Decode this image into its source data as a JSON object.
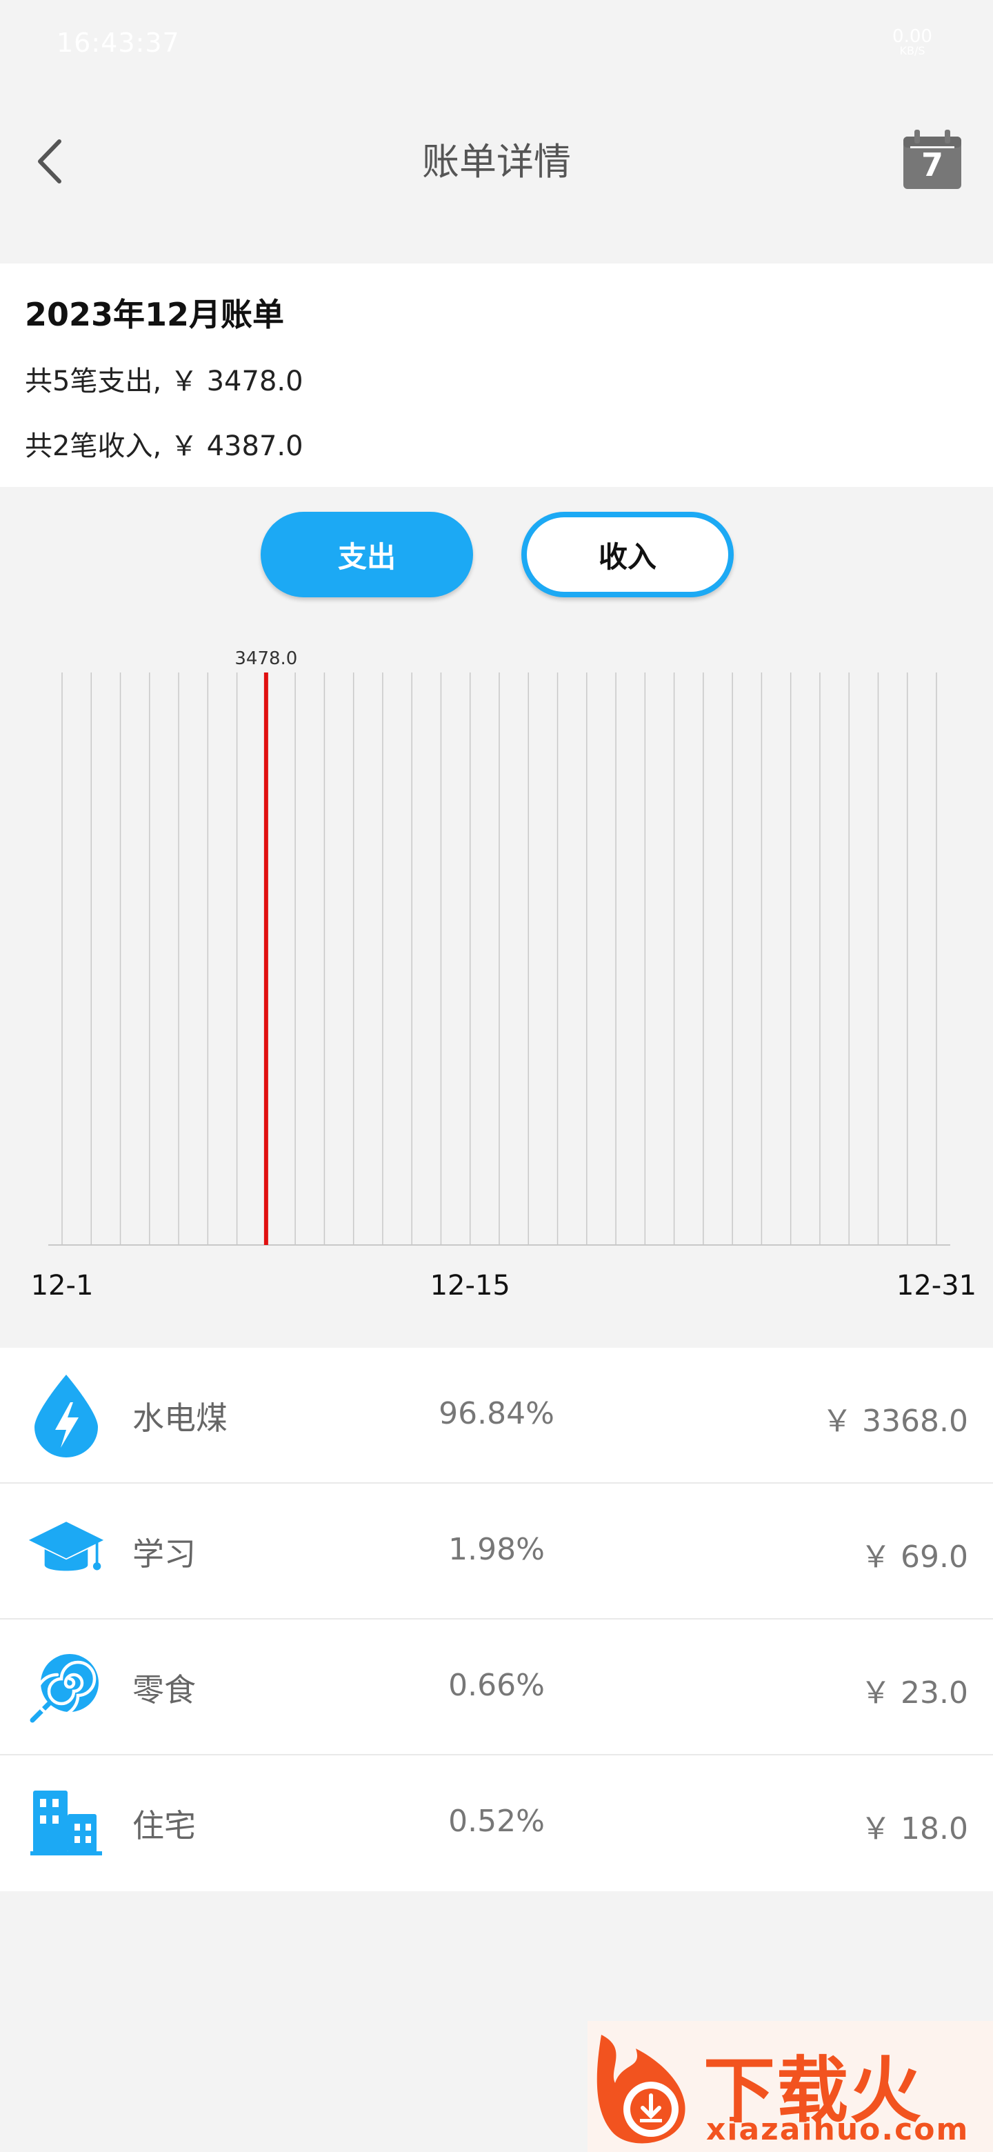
{
  "status_bar": {
    "time": "16:43:37",
    "net_speed": "0.00",
    "net_unit": "KB/S"
  },
  "header": {
    "title": "账单详情",
    "calendar_day": "7"
  },
  "summary": {
    "title": "2023年12月账单",
    "expense_line": "共5笔支出, ￥ 3478.0",
    "income_line": "共2笔收入, ￥ 4387.0"
  },
  "toggle": {
    "expense_label": "支出",
    "income_label": "收入",
    "selected": "expense"
  },
  "chart_data": {
    "type": "bar",
    "x": [
      "12-1",
      "12-2",
      "12-3",
      "12-4",
      "12-5",
      "12-6",
      "12-7",
      "12-8",
      "12-9",
      "12-10",
      "12-11",
      "12-12",
      "12-13",
      "12-14",
      "12-15",
      "12-16",
      "12-17",
      "12-18",
      "12-19",
      "12-20",
      "12-21",
      "12-22",
      "12-23",
      "12-24",
      "12-25",
      "12-26",
      "12-27",
      "12-28",
      "12-29",
      "12-30",
      "12-31"
    ],
    "values": [
      0,
      0,
      0,
      0,
      0,
      0,
      0,
      3478.0,
      0,
      0,
      0,
      0,
      0,
      0,
      0,
      0,
      0,
      0,
      0,
      0,
      0,
      0,
      0,
      0,
      0,
      0,
      0,
      0,
      0,
      0,
      0
    ],
    "x_tick_labels": [
      "12-1",
      "12-15",
      "12-31"
    ],
    "data_label": "3478.0",
    "bar_color": "#e01010",
    "grid_color": "#c8c8c8"
  },
  "categories": [
    {
      "name": "水电煤",
      "percent": "96.84%",
      "amount": "￥ 3368.0",
      "icon": "utility-drop-icon"
    },
    {
      "name": "学习",
      "percent": "1.98%",
      "amount": "￥ 69.0",
      "icon": "graduation-cap-icon"
    },
    {
      "name": "零食",
      "percent": "0.66%",
      "amount": "￥ 23.0",
      "icon": "lollipop-icon"
    },
    {
      "name": "住宅",
      "percent": "0.52%",
      "amount": "￥ 18.0",
      "icon": "building-icon"
    }
  ],
  "colors": {
    "accent": "#1ca9f4",
    "bar": "#e01010"
  },
  "watermark": {
    "brand": "下载火",
    "domain": "xiazaihuo.com"
  }
}
